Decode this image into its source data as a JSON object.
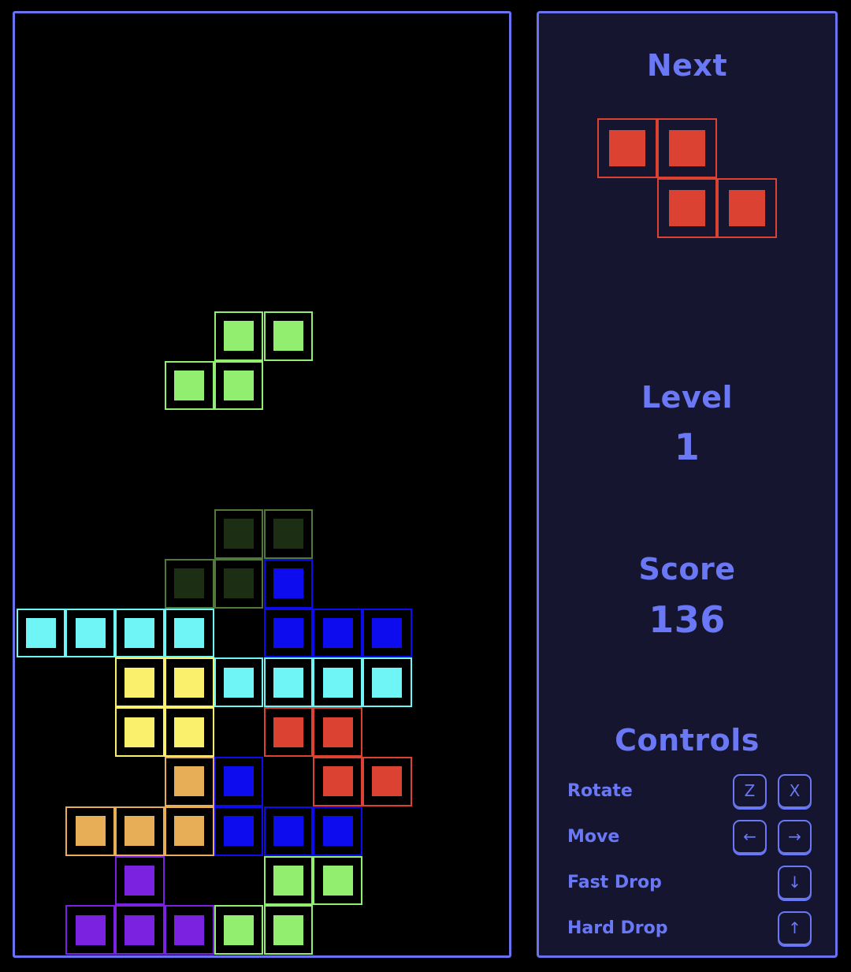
{
  "board": {
    "cols": 10,
    "rows": 19,
    "border_color": "#6A72F0",
    "background": "#000000",
    "piece_colors": {
      "cyan": "#6FF5F5",
      "blue": "#0C0CEE",
      "orange": "#E8AE57",
      "yellow": "#FAF06C",
      "green": "#92EE6E",
      "purple": "#7B22E0",
      "red": "#DC4232",
      "ghost": "#1C2E13",
      "ghost_border": "#4F7A3C"
    },
    "active_piece": {
      "name": "S-piece",
      "color": "green"
    },
    "ghost_piece": {
      "name": "ghost-S-piece",
      "color": "ghost"
    },
    "cells": [
      {
        "row": 7,
        "col": 4,
        "color": "green",
        "kind": "active"
      },
      {
        "row": 7,
        "col": 5,
        "color": "green",
        "kind": "active"
      },
      {
        "row": 8,
        "col": 3,
        "color": "green",
        "kind": "active"
      },
      {
        "row": 8,
        "col": 4,
        "color": "green",
        "kind": "active"
      },
      {
        "row": 11,
        "col": 4,
        "color": "ghost",
        "kind": "ghost"
      },
      {
        "row": 11,
        "col": 5,
        "color": "ghost",
        "kind": "ghost"
      },
      {
        "row": 12,
        "col": 3,
        "color": "ghost",
        "kind": "ghost"
      },
      {
        "row": 12,
        "col": 4,
        "color": "ghost",
        "kind": "ghost"
      },
      {
        "row": 12,
        "col": 5,
        "color": "blue",
        "kind": "locked"
      },
      {
        "row": 13,
        "col": 0,
        "color": "cyan",
        "kind": "locked"
      },
      {
        "row": 13,
        "col": 1,
        "color": "cyan",
        "kind": "locked"
      },
      {
        "row": 13,
        "col": 2,
        "color": "cyan",
        "kind": "locked"
      },
      {
        "row": 13,
        "col": 3,
        "color": "cyan",
        "kind": "locked"
      },
      {
        "row": 13,
        "col": 5,
        "color": "blue",
        "kind": "locked"
      },
      {
        "row": 13,
        "col": 6,
        "color": "blue",
        "kind": "locked"
      },
      {
        "row": 13,
        "col": 7,
        "color": "blue",
        "kind": "locked"
      },
      {
        "row": 14,
        "col": 2,
        "color": "yellow",
        "kind": "locked"
      },
      {
        "row": 14,
        "col": 3,
        "color": "yellow",
        "kind": "locked"
      },
      {
        "row": 14,
        "col": 4,
        "color": "cyan",
        "kind": "locked"
      },
      {
        "row": 14,
        "col": 5,
        "color": "cyan",
        "kind": "locked"
      },
      {
        "row": 14,
        "col": 6,
        "color": "cyan",
        "kind": "locked"
      },
      {
        "row": 14,
        "col": 7,
        "color": "cyan",
        "kind": "locked"
      },
      {
        "row": 15,
        "col": 2,
        "color": "yellow",
        "kind": "locked"
      },
      {
        "row": 15,
        "col": 3,
        "color": "yellow",
        "kind": "locked"
      },
      {
        "row": 15,
        "col": 5,
        "color": "red",
        "kind": "locked"
      },
      {
        "row": 15,
        "col": 6,
        "color": "red",
        "kind": "locked"
      },
      {
        "row": 16,
        "col": 3,
        "color": "orange",
        "kind": "locked"
      },
      {
        "row": 16,
        "col": 4,
        "color": "blue",
        "kind": "locked"
      },
      {
        "row": 16,
        "col": 6,
        "color": "red",
        "kind": "locked"
      },
      {
        "row": 16,
        "col": 7,
        "color": "red",
        "kind": "locked"
      },
      {
        "row": 17,
        "col": 1,
        "color": "orange",
        "kind": "locked"
      },
      {
        "row": 17,
        "col": 2,
        "color": "orange",
        "kind": "locked"
      },
      {
        "row": 17,
        "col": 3,
        "color": "orange",
        "kind": "locked"
      },
      {
        "row": 17,
        "col": 4,
        "color": "blue",
        "kind": "locked"
      },
      {
        "row": 17,
        "col": 5,
        "color": "blue",
        "kind": "locked"
      },
      {
        "row": 17,
        "col": 6,
        "color": "blue",
        "kind": "locked"
      },
      {
        "row": 18,
        "col": 2,
        "color": "purple",
        "kind": "locked"
      },
      {
        "row": 18,
        "col": 5,
        "color": "green",
        "kind": "locked"
      },
      {
        "row": 18,
        "col": 6,
        "color": "green",
        "kind": "locked"
      },
      {
        "row": 19,
        "col": 1,
        "color": "purple",
        "kind": "locked"
      },
      {
        "row": 19,
        "col": 2,
        "color": "purple",
        "kind": "locked"
      },
      {
        "row": 19,
        "col": 3,
        "color": "purple",
        "kind": "locked"
      },
      {
        "row": 19,
        "col": 4,
        "color": "green",
        "kind": "locked"
      },
      {
        "row": 19,
        "col": 5,
        "color": "green",
        "kind": "locked"
      }
    ]
  },
  "panel": {
    "background": "#151530",
    "border_color": "#6A72F0",
    "accent": "#6A78F5",
    "next": {
      "title": "Next",
      "piece_name": "S-piece",
      "piece_color": "#DC4232",
      "cells": [
        {
          "row": 0,
          "col": 0
        },
        {
          "row": 0,
          "col": 1
        },
        {
          "row": 1,
          "col": 1
        },
        {
          "row": 1,
          "col": 2
        }
      ]
    },
    "level": {
      "title": "Level",
      "value": "1"
    },
    "score": {
      "title": "Score",
      "value": "136"
    },
    "controls": {
      "title": "Controls",
      "rows": [
        {
          "label": "Rotate",
          "keys": [
            "Z",
            "X"
          ]
        },
        {
          "label": "Move",
          "keys": [
            "←",
            "→"
          ]
        },
        {
          "label": "Fast Drop",
          "keys": [
            "↓"
          ]
        },
        {
          "label": "Hard Drop",
          "keys": [
            "↑"
          ]
        }
      ]
    }
  }
}
